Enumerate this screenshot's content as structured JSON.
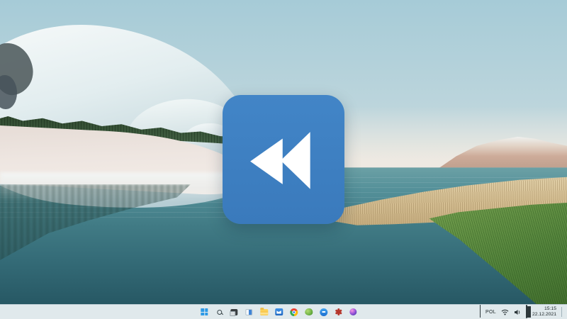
{
  "wallpaper": {
    "description": "winter lake landscape with glacier hills, treeline, teal water, distant tan mountain and grassy bank",
    "colors": {
      "sky_top": "#a6cbd7",
      "sky_horizon": "#e9e9e2",
      "water_top": "#6ba0a5",
      "water_bottom": "#275864",
      "glacier": "#e2edef",
      "treeline": "#3b583c",
      "sand_slope": "#eee6e1",
      "mountain": "#cdab99",
      "grass_tan": "#d5bf93",
      "grass_green": "#629044"
    }
  },
  "center_overlay": {
    "name": "rewind-logo",
    "glyph": "double-left-triangles",
    "background": "#3e7fc0",
    "glyph_color": "#ffffff"
  },
  "taskbar": {
    "background": "#e9f2f6",
    "pinned": [
      {
        "name": "start"
      },
      {
        "name": "search"
      },
      {
        "name": "task-view"
      },
      {
        "name": "widgets"
      },
      {
        "name": "file-explorer"
      },
      {
        "name": "mail"
      },
      {
        "name": "chrome"
      },
      {
        "name": "green-app"
      },
      {
        "name": "blue-round-app"
      },
      {
        "name": "red-pinwheel-app"
      },
      {
        "name": "purple-sphere-app"
      }
    ],
    "tray": {
      "language": "POL",
      "status_icons": [
        "wifi",
        "volume",
        "battery"
      ],
      "time": "15:15",
      "date": "22.12.2021"
    }
  }
}
